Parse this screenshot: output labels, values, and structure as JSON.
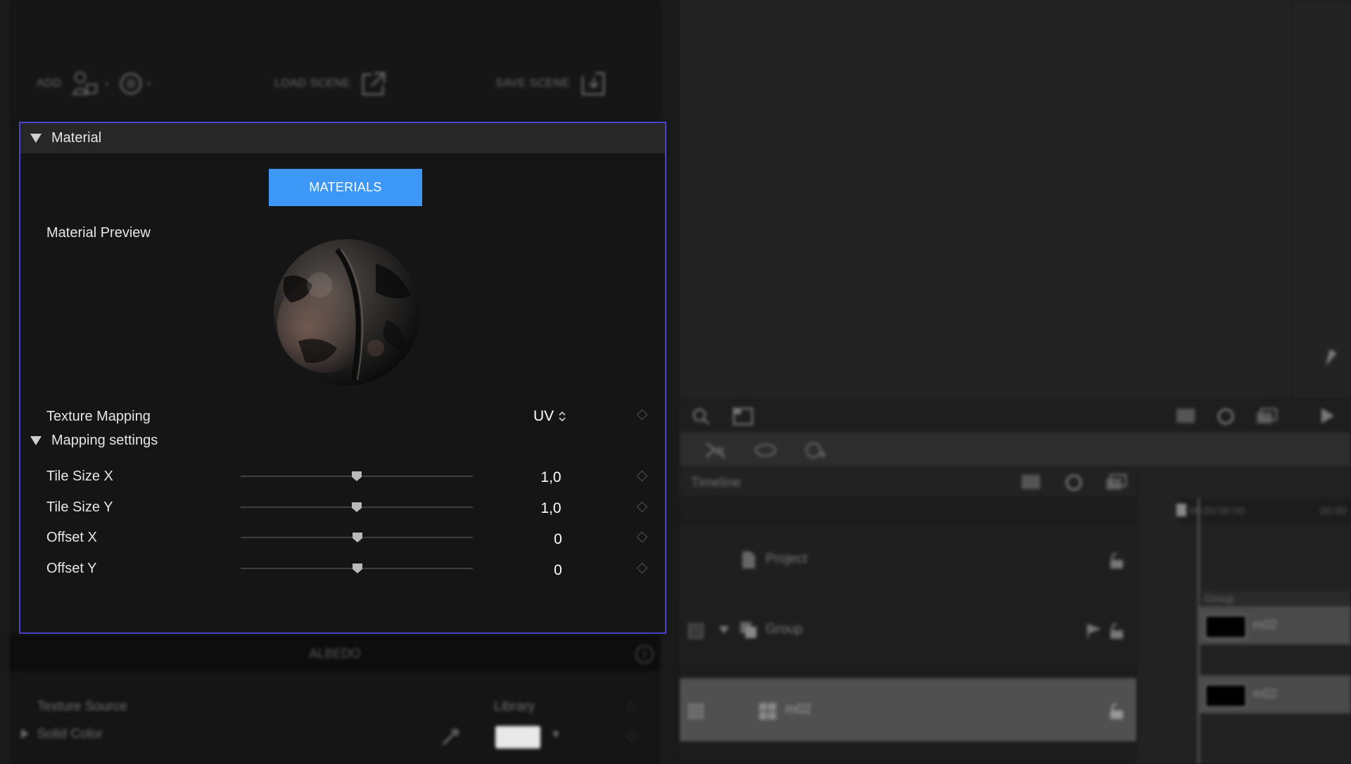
{
  "toolbar": {
    "add_label": "ADD",
    "load_scene_label": "LOAD SCENE",
    "save_scene_label": "SAVE SCENE"
  },
  "material": {
    "header_label": "Material",
    "materials_button_label": "MATERIALS",
    "preview_label": "Material Preview",
    "texture_mapping_label": "Texture Mapping",
    "texture_mapping_value": "UV",
    "mapping_settings_label": "Mapping settings",
    "params": [
      {
        "label": "Tile Size X",
        "value": "1,0",
        "slider_fraction": 0.5
      },
      {
        "label": "Tile Size Y",
        "value": "1,0",
        "slider_fraction": 0.5
      },
      {
        "label": "Offset X",
        "value": "0",
        "slider_fraction": 0.5
      },
      {
        "label": "Offset Y",
        "value": "0",
        "slider_fraction": 0.5
      }
    ]
  },
  "albedo": {
    "header_label": "ALBEDO",
    "texture_source_label": "Texture Source",
    "texture_source_value": "Library",
    "solid_color_label": "Solid Color",
    "swatch_color": "#e8e8e8"
  },
  "timeline": {
    "label": "Timeline",
    "timecode": "00:00:00:00",
    "timecode_right": "00:00",
    "project_label": "Project",
    "group_label": "Group",
    "layer_label": "m02",
    "track_group_label": "Group",
    "track_clip_label_1": "m02",
    "track_clip_label_2": "m02"
  },
  "colors": {
    "accent_button": "#3c97f7",
    "selection_border": "#4b43c9"
  }
}
